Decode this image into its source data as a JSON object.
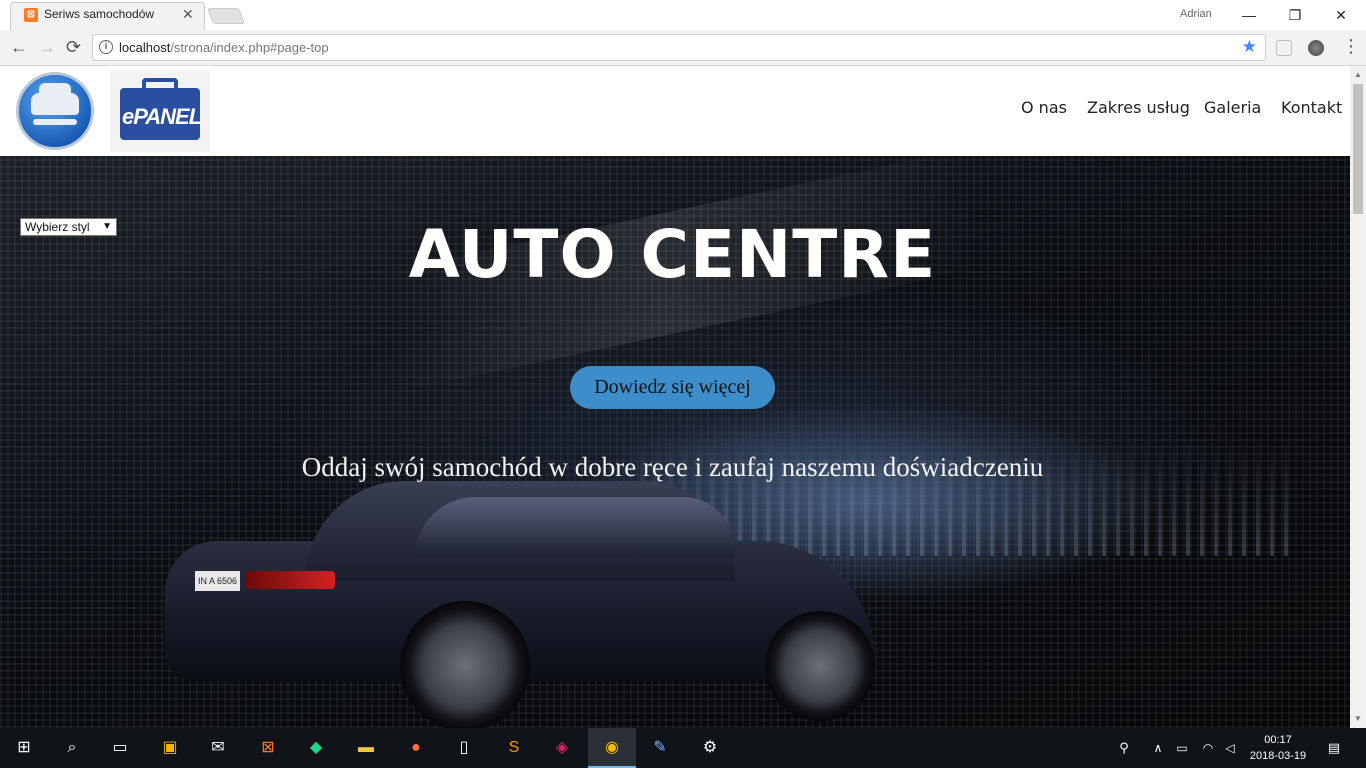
{
  "browser": {
    "tab_title": "Seriws samochodów",
    "tab_close": "✕",
    "user": "Adrian",
    "minimize": "—",
    "restore": "❐",
    "close": "✕",
    "url_host": "localhost",
    "url_path": "/strona/index.php#page-top",
    "back": "←",
    "forward": "→",
    "reload": "⟳",
    "star": "★",
    "menu": "⋮"
  },
  "site": {
    "nav": [
      "O nas",
      "Zakres usług",
      "Galeria",
      "Kontakt"
    ],
    "epanel_logo": "ePANEL"
  },
  "hero": {
    "style_select": "Wybierz styl",
    "title": "AUTO CENTRE",
    "button": "Dowiedz się więcej",
    "subtitle": "Oddaj swój samochód w dobre ręce i zaufaj naszemu doświadczeniu",
    "plate": "IN A 6506"
  },
  "taskbar": {
    "time": "00:17",
    "date": "2018-03-19"
  },
  "colors": {
    "accent_button": "#3c8dc9",
    "bookmark_star": "#4285f4",
    "xampp_orange": "#fb7a24"
  }
}
